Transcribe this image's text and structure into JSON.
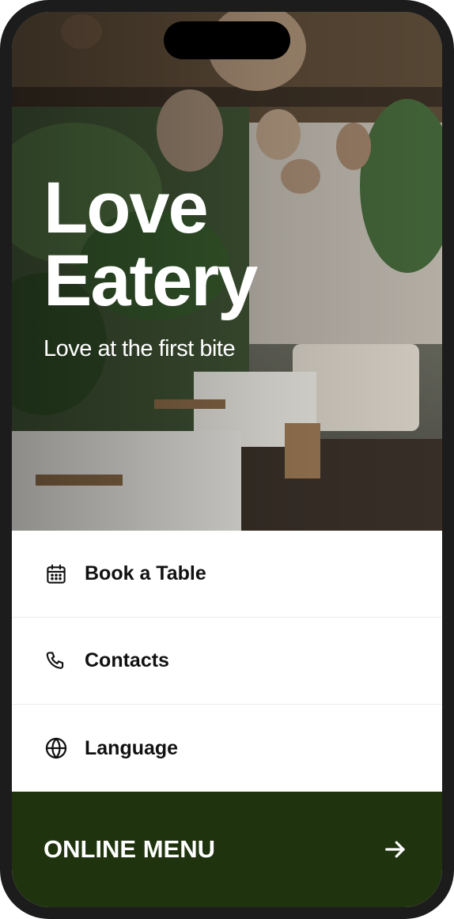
{
  "hero": {
    "title_line1": "Love",
    "title_line2": "Eatery",
    "tagline": "Love at the first bite"
  },
  "menu": {
    "items": [
      {
        "label": "Book a Table",
        "icon": "calendar-icon"
      },
      {
        "label": "Contacts",
        "icon": "phone-icon"
      },
      {
        "label": "Language",
        "icon": "globe-icon"
      }
    ]
  },
  "cta": {
    "label": "ONLINE MENU",
    "icon": "arrow-right-icon",
    "background": "#1f330e"
  }
}
